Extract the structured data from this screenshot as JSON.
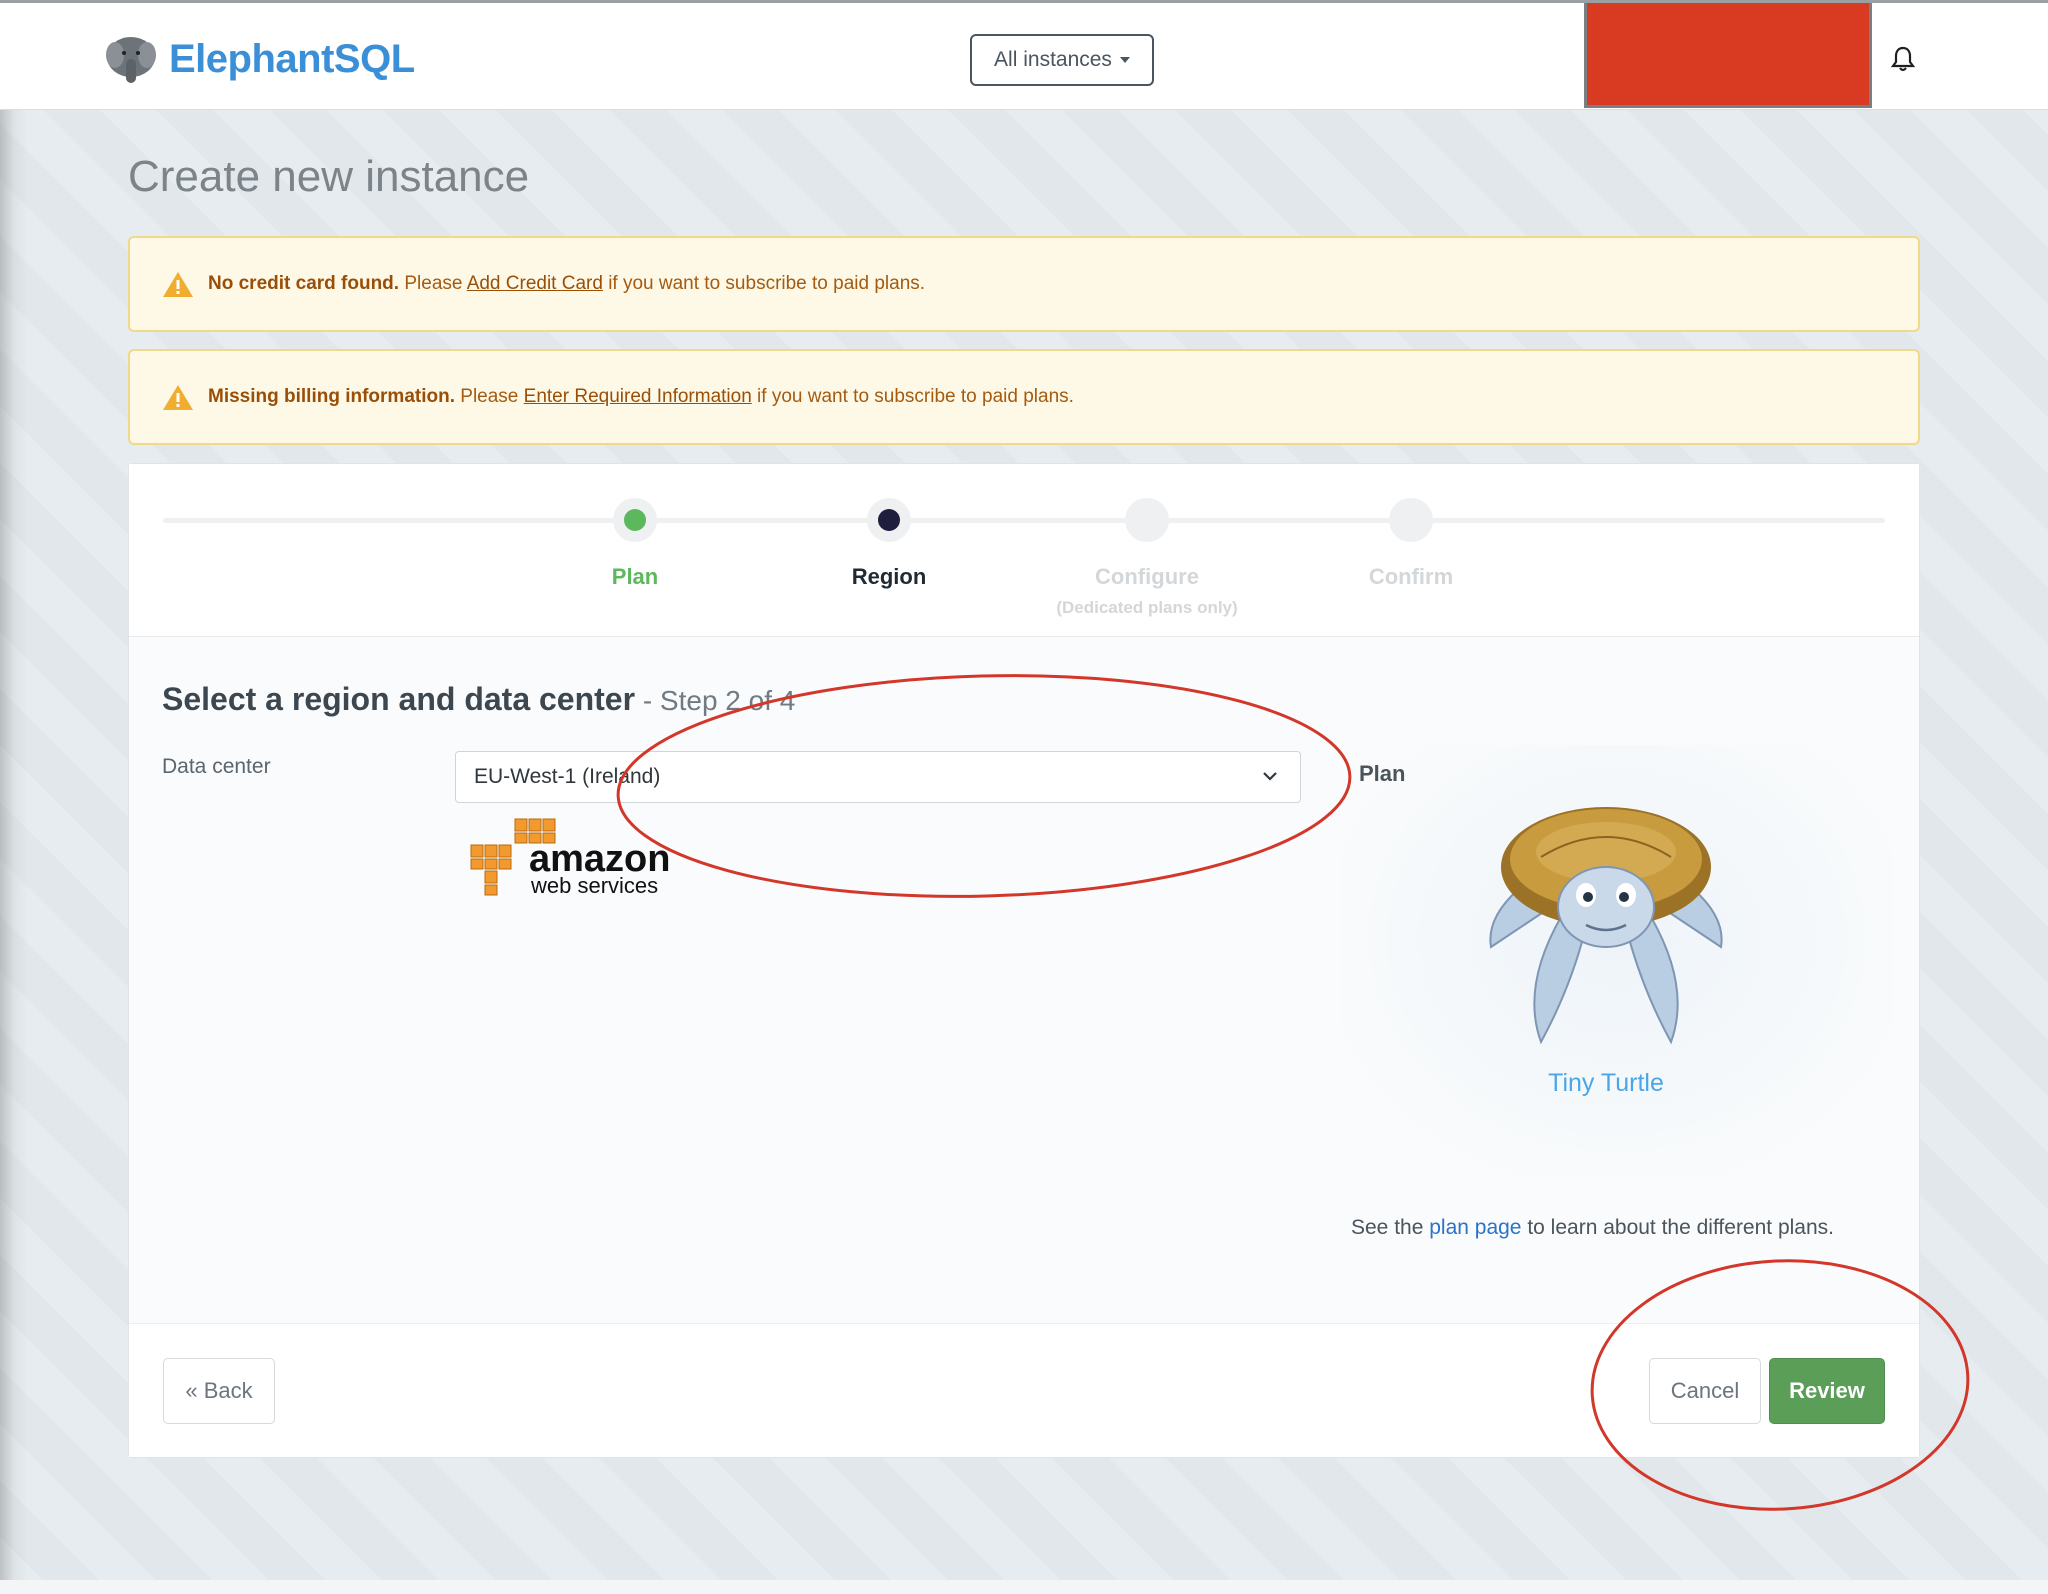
{
  "header": {
    "app_name": "ElephantSQL",
    "instances_dropdown": "All instances"
  },
  "page": {
    "title": "Create new instance"
  },
  "alerts": [
    {
      "bold": "No credit card found.",
      "before_link": " Please ",
      "link": "Add Credit Card",
      "after_link": " if you want to subscribe to paid plans."
    },
    {
      "bold": "Missing billing information.",
      "before_link": " Please ",
      "link": "Enter Required Information",
      "after_link": " if you want to subscribe to paid plans."
    }
  ],
  "steps": [
    {
      "label": "Plan",
      "state": "done",
      "color": "#5cb85c"
    },
    {
      "label": "Region",
      "state": "current",
      "color": "#1f1f3d"
    },
    {
      "label": "Configure",
      "sub": "(Dedicated plans only)",
      "state": "pending",
      "color": "#d3d7da"
    },
    {
      "label": "Confirm",
      "state": "pending",
      "color": "#d3d7da"
    }
  ],
  "region": {
    "title": "Select a region and data center",
    "step_text": " - Step 2 of 4",
    "data_center_label": "Data center",
    "data_center_value": "EU-West-1 (Ireland)",
    "provider_logo": {
      "line1": "amazon",
      "line2": "web services"
    }
  },
  "plan": {
    "label": "Plan",
    "name": "Tiny Turtle",
    "note_before": "See the ",
    "note_link": "plan page",
    "note_after": " to learn about the different plans."
  },
  "footer": {
    "back": "« Back",
    "cancel": "Cancel",
    "review": "Review"
  },
  "colors": {
    "brand": "#3a8fd6",
    "warning_bg": "#fdf9e6",
    "review_green": "#5a9e58",
    "annotation_red": "#d2372a",
    "redaction": "#d93a22"
  }
}
